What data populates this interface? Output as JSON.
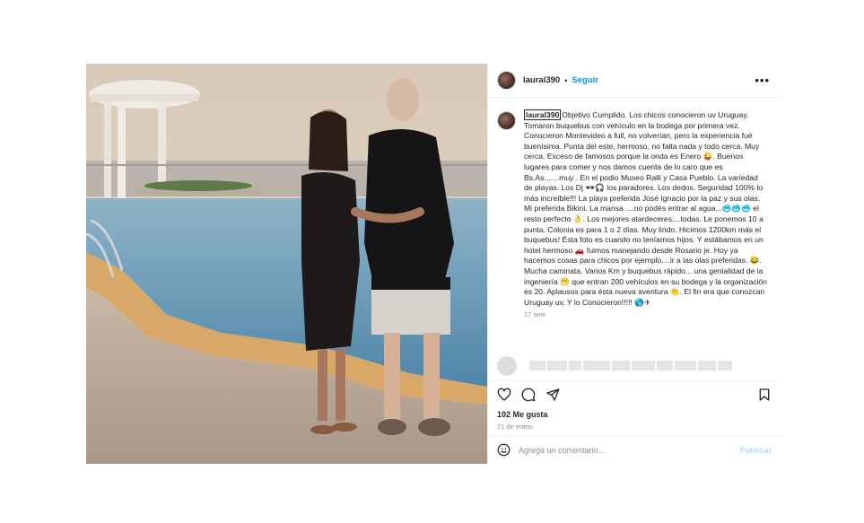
{
  "header": {
    "username": "laural390",
    "separator": "•",
    "follow_label": "Seguir",
    "more_icon": "more-horizontal-icon"
  },
  "caption": {
    "username": "laural390",
    "text": "Objetivo Cumplido. Los chicos conocieron uv Uruguay. Tomaron buquebus con vehículo en la bodega por primera vez. Conocieron Montevideo a full, no volverían, pero la experiencia fué buenísima. Punta del este, hermoso, no falta nada y todo cerca. Muy cerca. Exceso de famosos porque la onda es Enero 😜. Buenos lugares para comer y nos damos cuenta de lo caro que es Bs.As.......muy . En el podio Museo Ralli y Casa Pueblo. La variedad de playas. Los Dj 🕶🎧 los paradores. Los dedos. Seguridad 100% lo más increíble!!! La playa preferida José Ignacio por la paz y sus olas. Mi preferida Bikini. La mansa ....no podés entrar al agua...🥶🥶🥶 el resto perfecto 👌. Los mejores atardeceres....todas. Le ponemos 10 a punta. Colonia es para 1 o 2 días. Muy lindo. Hicimos 1200km más el buquebus! Ésta foto es cuando no teníamos hijos. Y estábamos en un hotel hermoso 🚗 fuimos manejando desde Rosario je. Hoy ya hacemos cosas para chicos por ejemplo....ir a las olas preferidas. 😂. Mucha caminata. Varios Km y buquebus rápido... una genialidad de la ingeniería 😁 que entran 200 vehículos en su bodega y la organización es 20. Aplausos para ésta nueva aventura 👏. El fin era que conozcan Uruguay uv. Y lo Conocieron!!!!! 🌎✈",
    "time": "17 sem"
  },
  "actions": {
    "like_icon": "heart-icon",
    "comment_icon": "comment-icon",
    "share_icon": "send-icon",
    "save_icon": "bookmark-icon"
  },
  "likes": "102 Me gusta",
  "date": "21 de enero",
  "comment_box": {
    "emoji_icon": "emoji-icon",
    "placeholder": "Agrega un comentario...",
    "publish_label": "Publicar"
  },
  "colors": {
    "link_blue": "#0095f6",
    "publish_disabled": "#b2dffc",
    "muted_text": "#8e8e8e",
    "border": "#efefef"
  }
}
